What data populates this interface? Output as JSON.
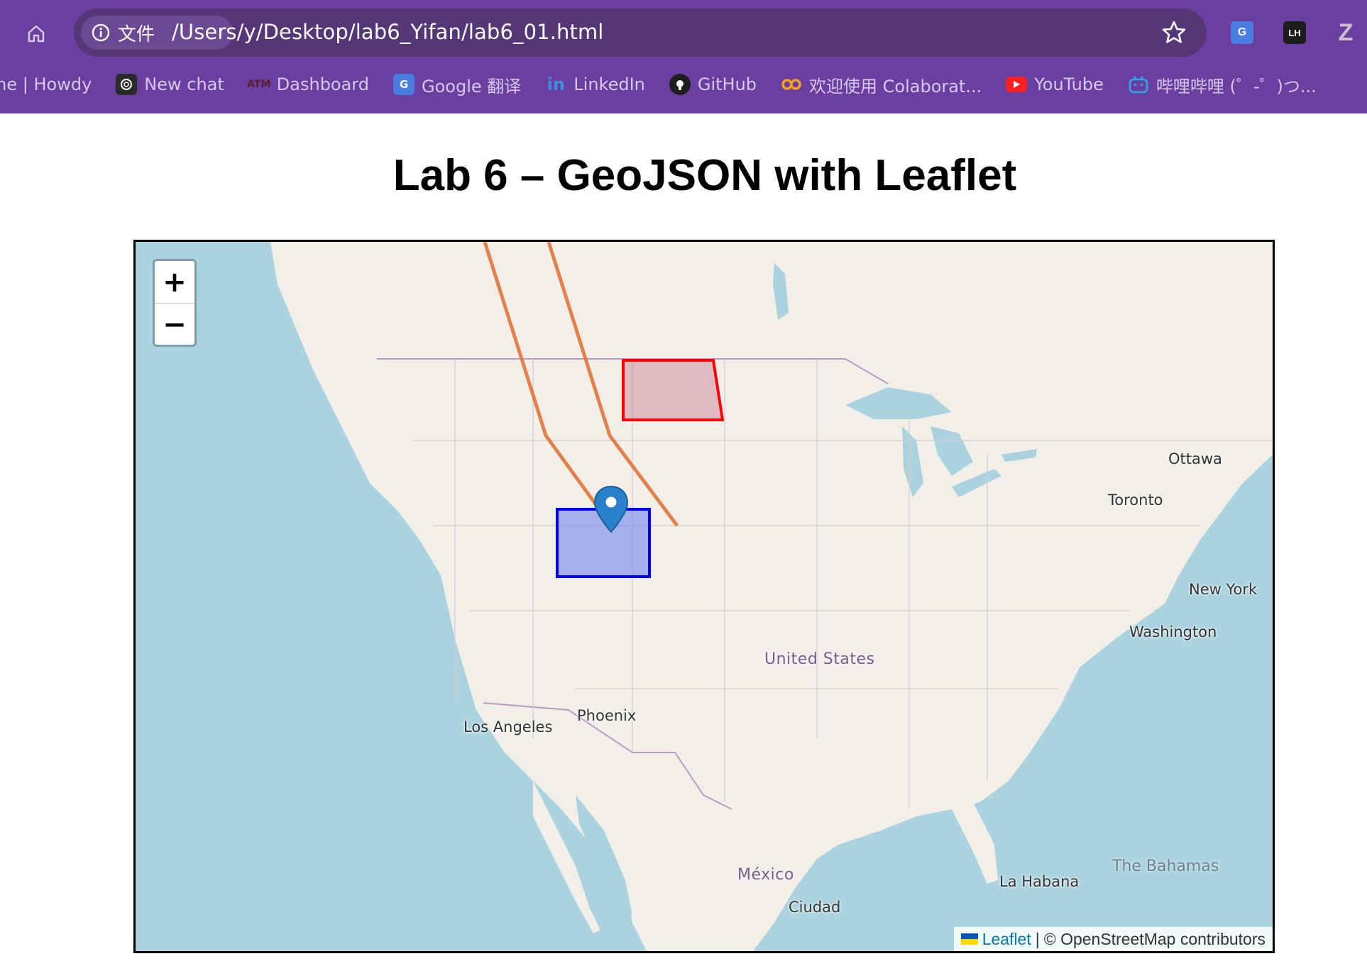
{
  "browser": {
    "site_chip_label": "文件",
    "url": "/Users/y/Desktop/lab6_Yifan/lab6_01.html",
    "extensions": [
      {
        "name": "google-translate-extension",
        "label": "G"
      },
      {
        "name": "lighthouse-extension",
        "label": "LH"
      },
      {
        "name": "zotero-extension",
        "label": "Z"
      }
    ],
    "bookmarks": [
      {
        "label": "me | Howdy",
        "icon": "none"
      },
      {
        "label": "New chat",
        "icon": "openai-icon"
      },
      {
        "label": "Dashboard",
        "icon": "tamu-icon"
      },
      {
        "label": "Google 翻译",
        "icon": "google-translate-icon"
      },
      {
        "label": "LinkedIn",
        "icon": "linkedin-icon"
      },
      {
        "label": "GitHub",
        "icon": "github-icon"
      },
      {
        "label": "欢迎使用 Colaborat...",
        "icon": "colab-icon"
      },
      {
        "label": "YouTube",
        "icon": "youtube-icon"
      },
      {
        "label": "哔哩哔哩 (゜-゜)つ...",
        "icon": "bilibili-icon"
      }
    ]
  },
  "page": {
    "title": "Lab 6 – GeoJSON with Leaflet"
  },
  "map": {
    "zoom_in": "+",
    "zoom_out": "−",
    "labels": {
      "ottawa": "Ottawa",
      "toronto": "Toronto",
      "new_york": "New York",
      "washington": "Washington",
      "united_states": "United States",
      "phoenix": "Phoenix",
      "los_angeles": "Los Angeles",
      "mexico": "México",
      "ciudad": "Ciudad",
      "la_habana": "La Habana",
      "the_bahamas": "The Bahamas"
    },
    "layers": {
      "polygon_1": {
        "stroke": "#ff0000",
        "fill": "#c97b93"
      },
      "polygon_2": {
        "stroke": "#0000ff",
        "fill": "#a0b1f0"
      },
      "lines": {
        "stroke": "#e0743a"
      },
      "marker": {
        "color": "#2a81cb"
      }
    },
    "attribution": {
      "leaflet": "Leaflet",
      "separator": "|",
      "osm": "© OpenStreetMap contributors"
    }
  }
}
